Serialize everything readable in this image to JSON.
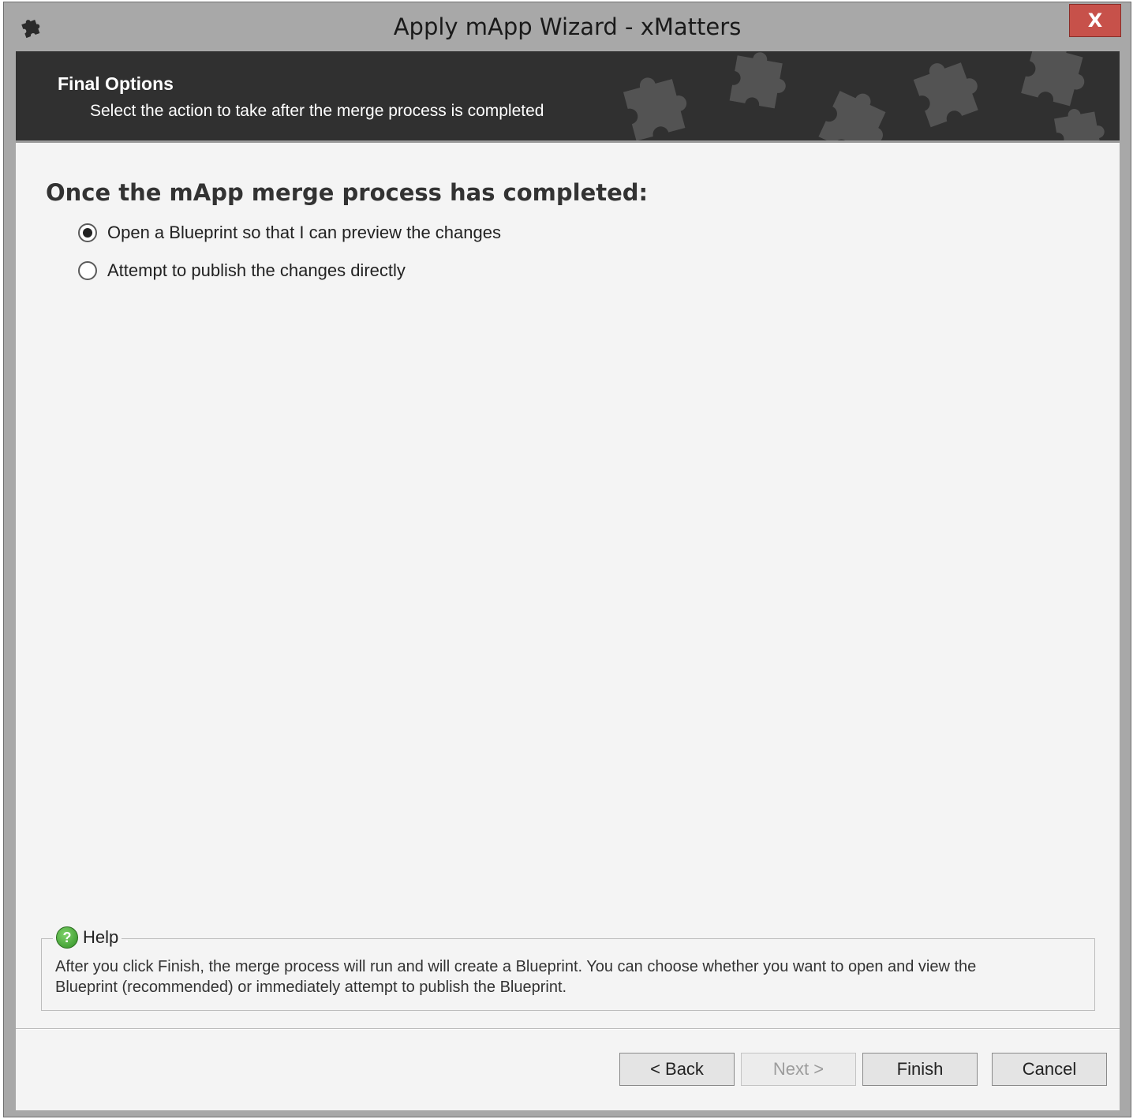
{
  "window": {
    "title": "Apply mApp Wizard - xMatters",
    "close_label": "X"
  },
  "header": {
    "title": "Final Options",
    "subtitle": "Select the action to take after the merge process is completed"
  },
  "main": {
    "heading": "Once the mApp merge process has completed:",
    "options": [
      {
        "label": "Open a Blueprint so that I can preview the changes",
        "selected": true
      },
      {
        "label": "Attempt to publish the changes directly",
        "selected": false
      }
    ]
  },
  "help": {
    "title": "Help",
    "icon": "help-question-icon",
    "line1": "After you click Finish, the merge process will run and will create a Blueprint.  You can choose whether you want to open and view the",
    "line2": "Blueprint (recommended) or immediately attempt to publish the Blueprint."
  },
  "buttons": {
    "back": "< Back",
    "next": "Next >",
    "finish": "Finish",
    "cancel": "Cancel"
  },
  "colors": {
    "header_bg": "#303030",
    "close_bg": "#c7514a",
    "client_bg": "#f4f4f4"
  }
}
